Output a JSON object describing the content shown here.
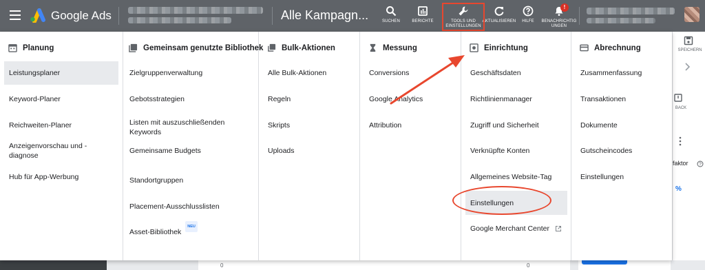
{
  "topbar": {
    "brand": "Google Ads",
    "campaign_title": "Alle Kampagn...",
    "tools": [
      {
        "label": "SUCHEN",
        "icon": "search-icon"
      },
      {
        "label": "BERICHTE",
        "icon": "reports-icon"
      },
      {
        "label": "TOOLS UND\nEINSTELLUNGEN",
        "icon": "wrench-icon"
      },
      {
        "label": "AKTUALISIEREN",
        "icon": "refresh-icon"
      },
      {
        "label": "HILFE",
        "icon": "help-icon"
      },
      {
        "label": "BENACHRICHTIG\nUNGEN",
        "icon": "bell-icon"
      }
    ],
    "notification_badge": "!"
  },
  "menu": {
    "columns": [
      {
        "title": "Planung",
        "icon": "calendar-icon",
        "items": [
          "Leistungsplaner",
          "Keyword-Planer",
          "Reichweiten-Planer",
          "Anzeigenvorschau und -diagnose",
          "Hub für App-Werbung"
        ]
      },
      {
        "title": "Gemeinsam genutzte Bibliothek",
        "icon": "library-icon",
        "items": [
          "Zielgruppenverwaltung",
          "Gebotsstrategien",
          "Listen mit auszuschließenden Keywords",
          "Gemeinsame Budgets",
          "Standortgruppen",
          "Placement-Ausschlusslisten",
          "Asset-Bibliothek"
        ],
        "new_badge": "NEU"
      },
      {
        "title": "Bulk-Aktionen",
        "icon": "copy-icon",
        "items": [
          "Alle Bulk-Aktionen",
          "Regeln",
          "Skripts",
          "Uploads"
        ]
      },
      {
        "title": "Messung",
        "icon": "hourglass-icon",
        "items": [
          "Conversions",
          "Google Analytics",
          "Attribution"
        ]
      },
      {
        "title": "Einrichtung",
        "icon": "setup-icon",
        "items": [
          "Geschäftsdaten",
          "Richtlinienmanager",
          "Zugriff und Sicherheit",
          "Verknüpfte Konten",
          "Allgemeines Website-Tag",
          "Einstellungen",
          "Google Merchant Center"
        ]
      },
      {
        "title": "Abrechnung",
        "icon": "credit-card-icon",
        "items": [
          "Zusammenfassung",
          "Transaktionen",
          "Dokumente",
          "Gutscheincodes",
          "Einstellungen"
        ]
      }
    ]
  },
  "background": {
    "save_label": "SPEICHERN",
    "back_label": "BACK",
    "faktor_label": "faktor",
    "percent": "%",
    "zero": "0"
  },
  "colors": {
    "topbar": "#5f6368",
    "annotation": "#e8472e",
    "active_item": "#e8eaed"
  }
}
